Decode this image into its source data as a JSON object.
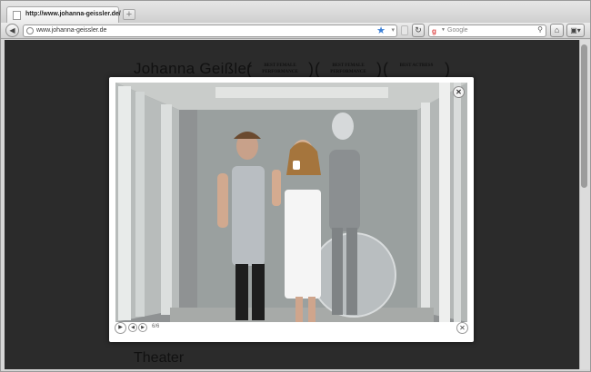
{
  "browser": {
    "tab_title": "http://www.johanna-geissler.de/",
    "new_tab_label": "+",
    "url": "www.johanna-geissler.de",
    "search_engine": "Google",
    "search_placeholder": "Google"
  },
  "site": {
    "title": "Johanna Geißler",
    "awards": [
      {
        "line1": "BEST FEMALE",
        "line2": "PERFORMANCE"
      },
      {
        "line1": "BEST FEMALE",
        "line2": "PERFORMANCE"
      },
      {
        "line1": "BEST ACTRESS",
        "line2": ""
      }
    ],
    "section_title": "Theater"
  },
  "lightbox": {
    "counter": "6/6",
    "close_glyph": "✕",
    "play_glyph": "▶",
    "prev_glyph": "◀",
    "next_glyph": "▶"
  },
  "colors": {
    "page_background": "#2b2b2b",
    "accent_star": "#3b7fd6"
  },
  "icons": [
    "globe-icon",
    "star-icon",
    "reload-icon",
    "google-icon",
    "search-icon",
    "home-icon",
    "menu-icon",
    "back-icon"
  ]
}
